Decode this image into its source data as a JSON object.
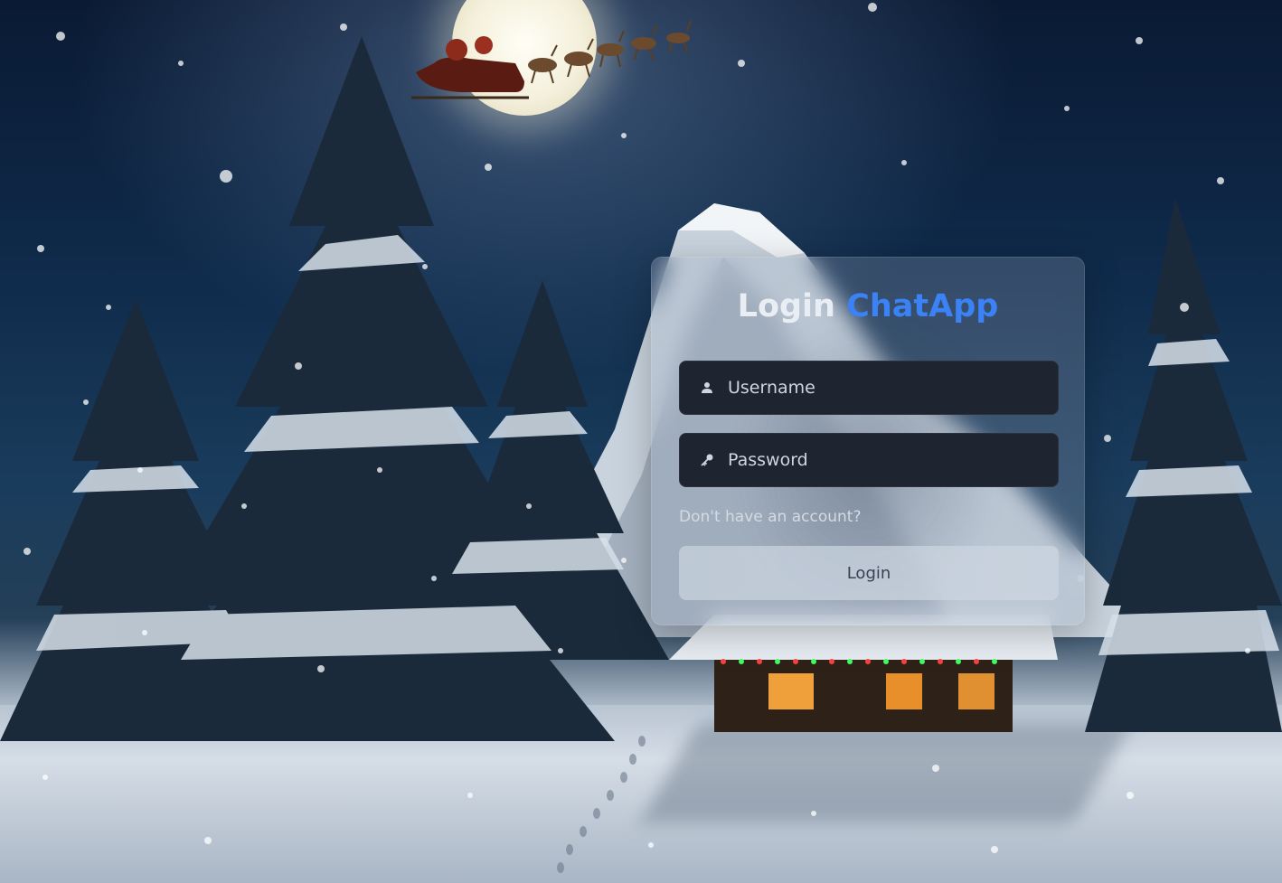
{
  "app": {
    "title_prefix": "Login",
    "title_brand": "ChatApp",
    "accent_color": "#3b82f6"
  },
  "form": {
    "username": {
      "placeholder": "Username",
      "value": "",
      "icon": "user-icon"
    },
    "password": {
      "placeholder": "Password",
      "value": "",
      "icon": "key-icon"
    },
    "signup_link": "Don't have an account?",
    "submit_label": "Login"
  },
  "background": {
    "theme": "snowy winter night with moon, Santa's sleigh, pine trees and lit cabin"
  }
}
